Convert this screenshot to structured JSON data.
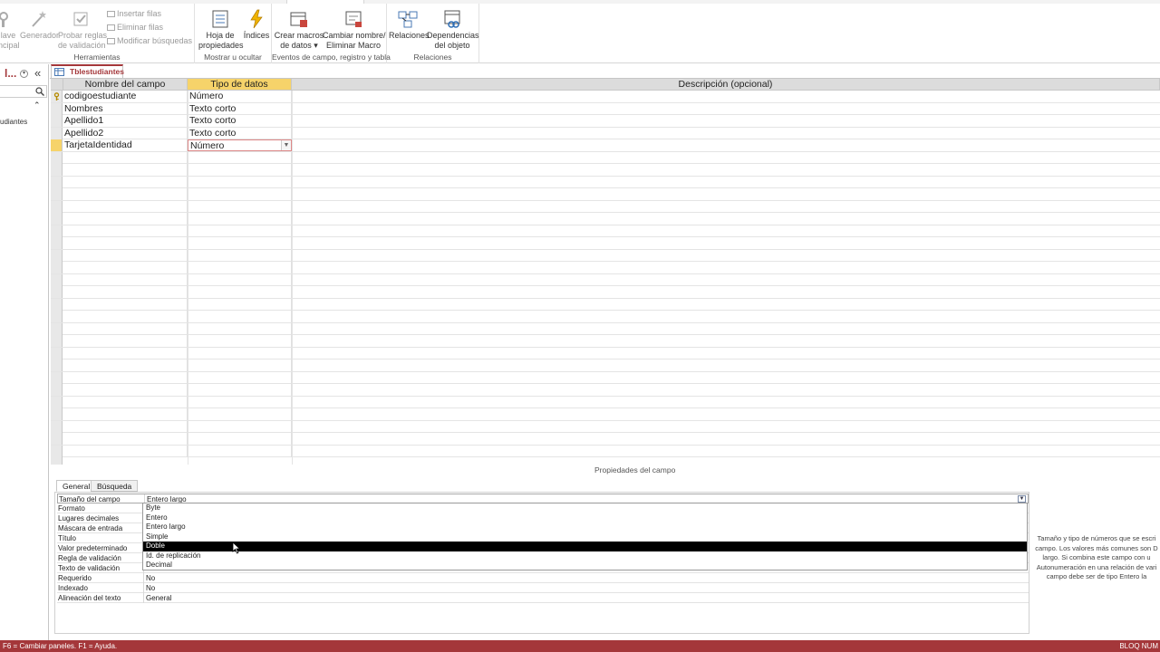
{
  "ribbon": {
    "groups": {
      "herramientas": "Herramientas",
      "mostrar": "Mostrar u ocultar",
      "eventos": "Eventos de campo, registro y tabla",
      "relaciones": "Relaciones"
    },
    "buttons": {
      "clave_l1": "lave",
      "clave_l2": "ncipal",
      "generador": "Generador",
      "probar_l1": "Probar reglas",
      "probar_l2": "de validación",
      "insertar": "Insertar filas",
      "eliminar": "Eliminar filas",
      "modificar": "Modificar búsquedas",
      "hoja_l1": "Hoja de",
      "hoja_l2": "propiedades",
      "indices": "Índices",
      "crear_l1": "Crear macros",
      "crear_l2": "de datos ▾",
      "cambiar_l1": "Cambiar nombre/",
      "cambiar_l2": "Eliminar Macro",
      "relaciones": "Relaciones",
      "dependencias_l1": "Dependencias",
      "dependencias_l2": "del objeto"
    }
  },
  "navpane": {
    "title": "l...",
    "collapse": "«",
    "category_toggle": "»",
    "item": "udiantes"
  },
  "document_tab": {
    "label": "Tblestudiantes"
  },
  "grid": {
    "headers": {
      "field_name": "Nombre del campo",
      "data_type": "Tipo de datos",
      "description": "Descripción (opcional)"
    },
    "rows": [
      {
        "field": "codigoestudiante",
        "type": "Número",
        "key": true
      },
      {
        "field": "Nombres",
        "type": "Texto corto"
      },
      {
        "field": "Apellido1",
        "type": "Texto corto"
      },
      {
        "field": "Apellido2",
        "type": "Texto corto"
      },
      {
        "field": "TarjetaIdentidad",
        "type": "Número",
        "current": true
      }
    ]
  },
  "properties": {
    "caption": "Propiedades del campo",
    "tabs": [
      "General",
      "Búsqueda"
    ],
    "rows": [
      {
        "name": "Tamaño del campo",
        "value": "Entero largo"
      },
      {
        "name": "Formato",
        "value": ""
      },
      {
        "name": "Lugares decimales",
        "value": ""
      },
      {
        "name": "Máscara de entrada",
        "value": ""
      },
      {
        "name": "Título",
        "value": ""
      },
      {
        "name": "Valor predeterminado",
        "value": ""
      },
      {
        "name": "Regla de validación",
        "value": ""
      },
      {
        "name": "Texto de validación",
        "value": ""
      },
      {
        "name": "Requerido",
        "value": "No"
      },
      {
        "name": "Indexado",
        "value": "No"
      },
      {
        "name": "Alineación del texto",
        "value": "General"
      }
    ],
    "dropdown_options": [
      "Byte",
      "Entero",
      "Entero largo",
      "Simple",
      "Doble",
      "Id. de replicación",
      "Decimal"
    ],
    "highlighted_option": "Doble",
    "help_lines": [
      "Tamaño y tipo de números que se escri",
      "campo. Los valores más comunes son D",
      "largo. Si combina este campo con u",
      "Autonumeración en una relación de vari",
      "campo debe ser de tipo Entero la"
    ]
  },
  "statusbar": {
    "left": "F6 = Cambiar paneles. F1 = Ayuda.",
    "right": "BLOQ NUM"
  },
  "colors": {
    "accent": "#a4373a",
    "selected_header": "#f6d36a",
    "highlight_option": "#000000"
  }
}
